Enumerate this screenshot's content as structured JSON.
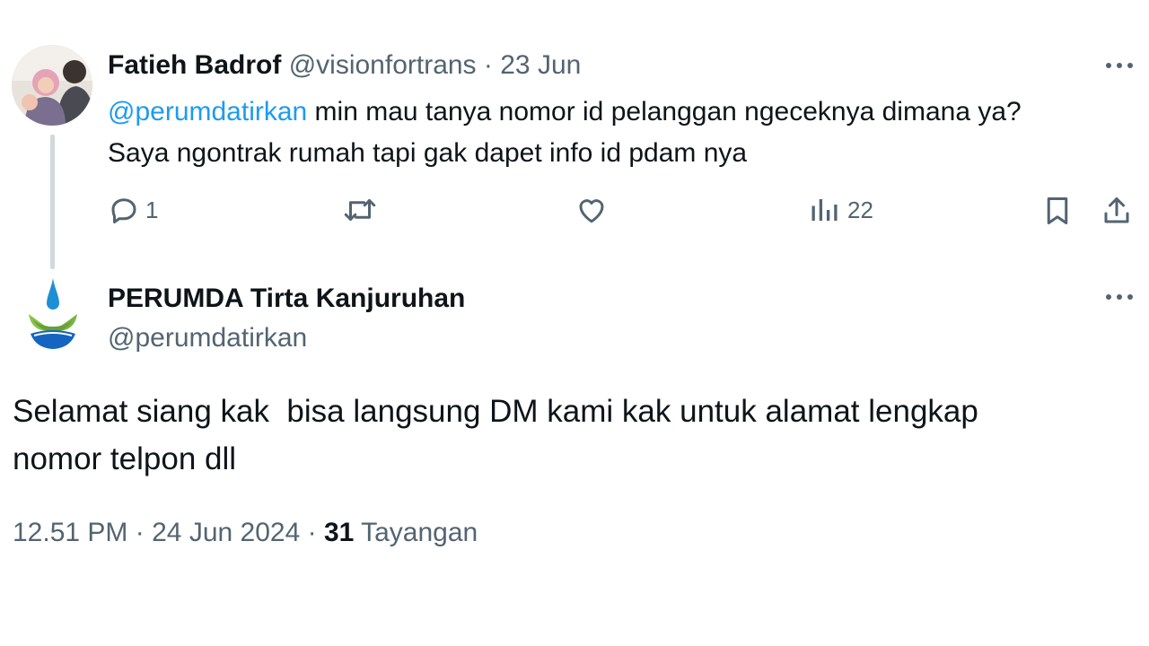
{
  "tweet1": {
    "author_name": "Fatieh Badrof",
    "handle": "@visionfortrans",
    "separator": "·",
    "date": "23 Jun",
    "mention": "@perumdatirkan",
    "text_after_mention": " min mau tanya nomor id pelanggan ngeceknya dimana ya?",
    "text_line2": "Saya ngontrak rumah tapi gak dapet info id pdam nya",
    "reply_count": "1",
    "views_count": "22",
    "icons": [
      "avatar-photo",
      "more-icon",
      "reply-icon",
      "retweet-icon",
      "like-icon",
      "views-icon",
      "bookmark-icon",
      "share-icon"
    ]
  },
  "tweet2": {
    "author_name": "PERUMDA Tirta Kanjuruhan",
    "handle": "@perumdatirkan",
    "text": "Selamat siang kak  bisa langsung DM kami kak untuk alamat lengkap\nnomor telpon dll",
    "time": "12.51 PM",
    "date": "24 Jun 2024",
    "separator": "·",
    "views_count": "31",
    "views_label": "Tayangan",
    "icons": [
      "logo-icon",
      "more-icon"
    ]
  },
  "colors": {
    "text": "#0f1419",
    "muted": "#536471",
    "link": "#1d9bf0",
    "thread_line": "#cfd9de"
  }
}
